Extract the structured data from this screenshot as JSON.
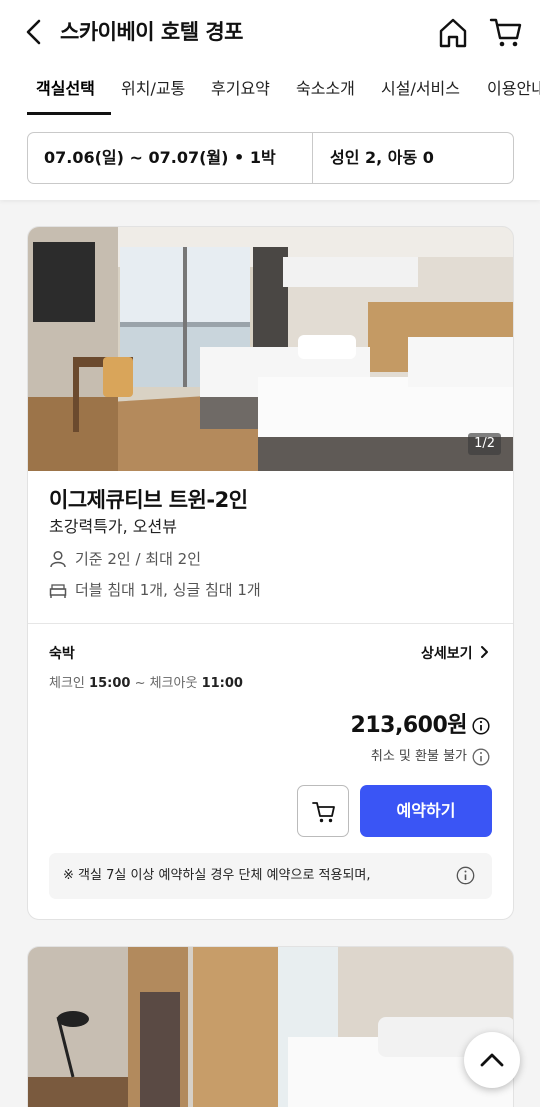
{
  "header": {
    "title": "스카이베이 호텔 경포",
    "back_icon": "chevron-left-icon",
    "home_icon": "home-icon",
    "cart_icon": "cart-icon"
  },
  "tabs": [
    {
      "label": "객실선택",
      "active": true
    },
    {
      "label": "위치/교통"
    },
    {
      "label": "후기요약"
    },
    {
      "label": "숙소소개"
    },
    {
      "label": "시설/서비스"
    },
    {
      "label": "이용안내"
    }
  ],
  "search": {
    "dates": "07.06(일) ~ 07.07(월) • 1박",
    "guests": "성인 2, 아동 0"
  },
  "room": {
    "image_counter": "1/2",
    "name": "이그제큐티브 트윈-2인",
    "subtitle": "초강력특가, 오션뷰",
    "capacity": "기준 2인 / 최대 2인",
    "beds": "더블 침대 1개, 싱글 침대 1개",
    "stay_type": "숙박",
    "detail_link": "상세보기",
    "checkin_label": "체크인",
    "checkin_time": "15:00",
    "checkout_label": "체크아웃",
    "checkout_time": "11:00",
    "price": "213,600원",
    "refund_policy": "취소 및 환불 불가",
    "reserve_button": "예약하기",
    "notice": "※ 객실 7실 이상 예약하실 경우 단체 예약으로 적용되며,"
  },
  "colors": {
    "accent": "#3a55f5",
    "background": "#f4f4f4"
  }
}
